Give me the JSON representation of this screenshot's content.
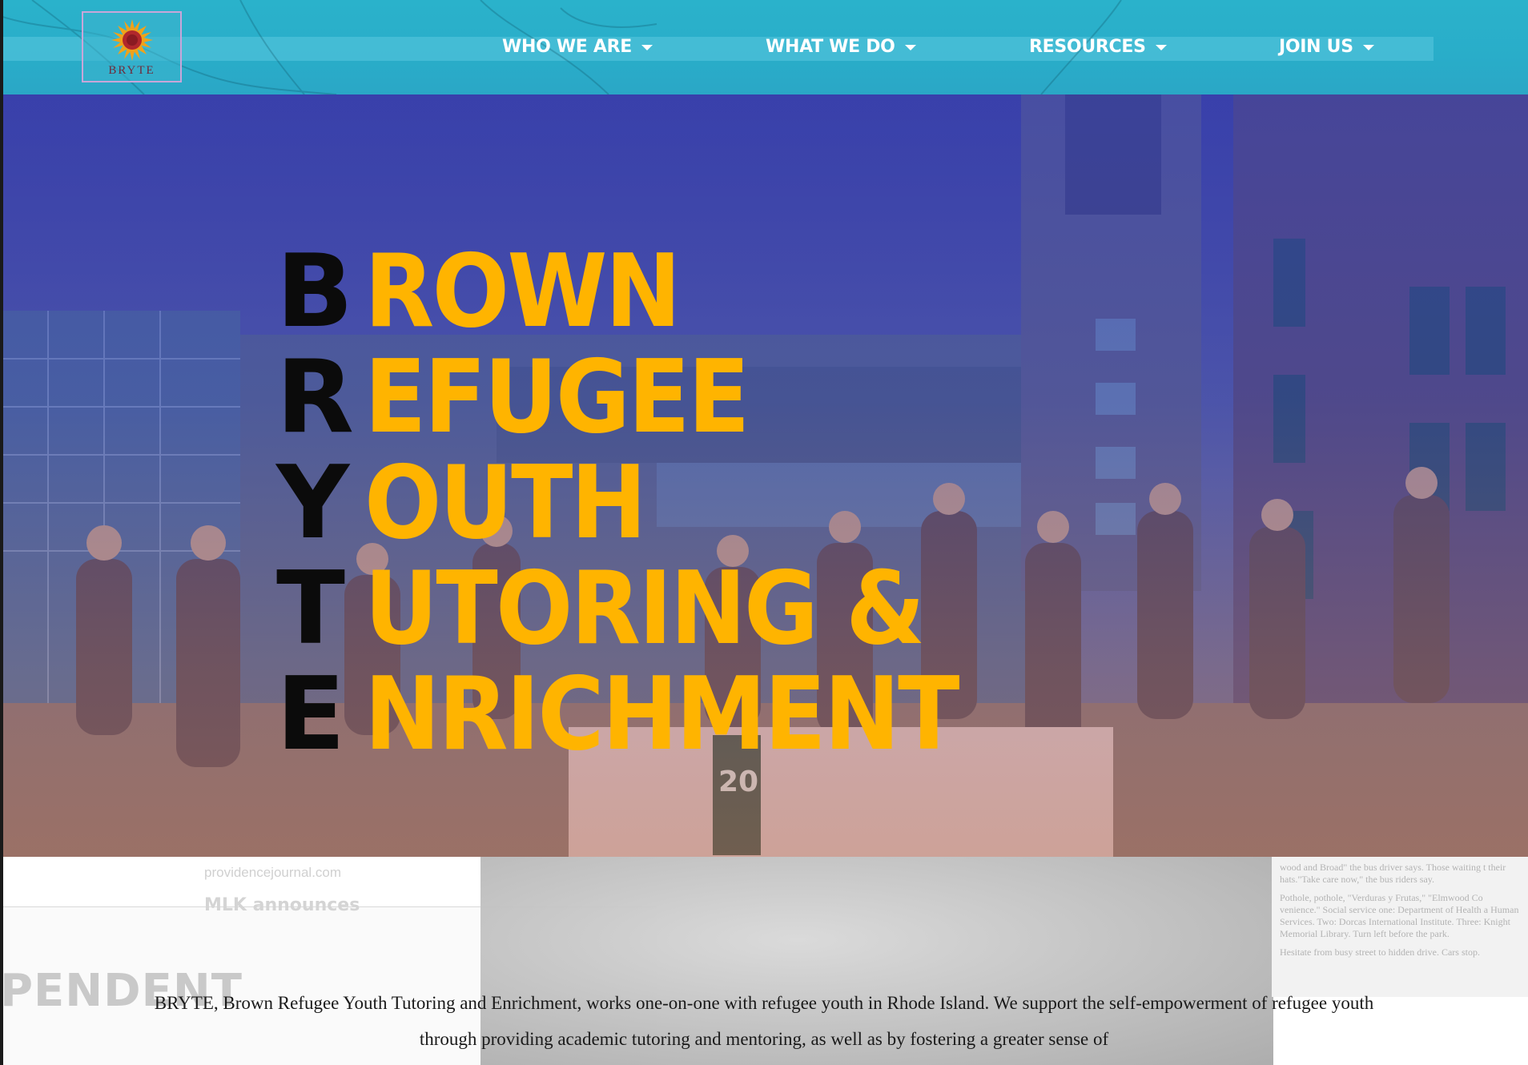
{
  "header": {
    "logo_text": "BRYTE",
    "nav": [
      {
        "label": "WHO WE ARE"
      },
      {
        "label": "WHAT WE DO"
      },
      {
        "label": "RESOURCES"
      },
      {
        "label": "JOIN US"
      }
    ]
  },
  "hero": {
    "acronym": [
      {
        "letter": "B",
        "rest": "ROWN"
      },
      {
        "letter": "R",
        "rest": "EFUGEE"
      },
      {
        "letter": "Y",
        "rest": "OUTH"
      },
      {
        "letter": "T",
        "rest": "UTORING &"
      },
      {
        "letter": "E",
        "rest": "NRICHMENT"
      }
    ],
    "banner_number": "20"
  },
  "collage": {
    "newspaper_title": "PENDENT",
    "newspaper_source": "providencejournal.com",
    "newspaper_headline": "MLK announces",
    "right_text": [
      "wood and Broad\" the bus driver says. Those waiting t their hats.\"Take care now,\" the bus riders say.",
      "Pothole, pothole, \"Verduras y Frutas,\" \"Elmwood Co venience.\" Social service one: Department of Health a Human Services. Two: Dorcas International Institute. Three: Knight Memorial Library. Turn left before the park.",
      "Hesitate from busy street to hidden drive. Cars stop."
    ]
  },
  "intro": {
    "text": "BRYTE, Brown Refugee Youth Tutoring and Enrichment, works one-on-one with refugee youth in Rhode Island. We support the self-empowerment of refugee youth through providing academic tutoring and mentoring, as well as by fostering a greater sense of"
  },
  "colors": {
    "header": "#2ab2cb",
    "acronym_letter": "#0b0b0b",
    "acronym_word": "#ffb400",
    "logo_border": "#c8a6d9"
  }
}
